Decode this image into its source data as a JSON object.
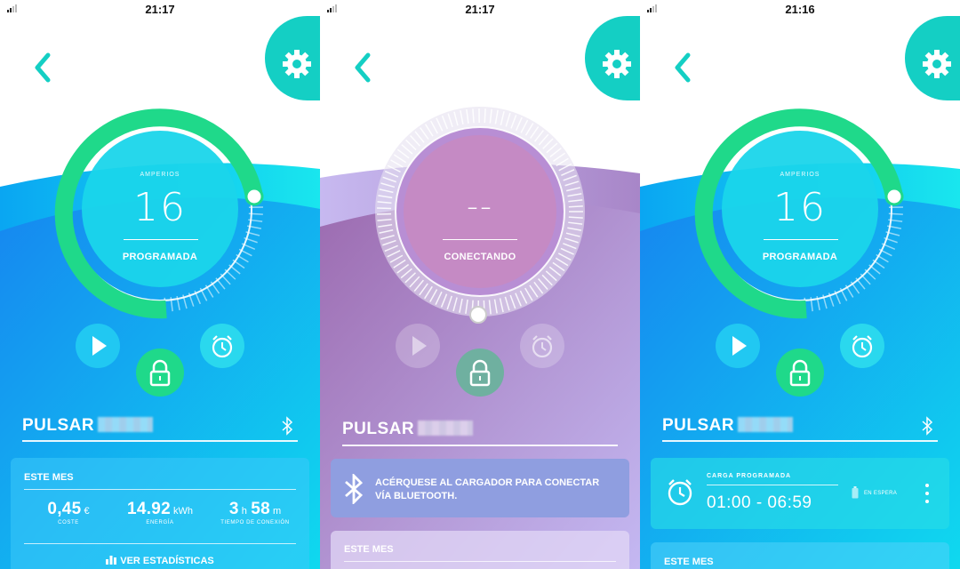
{
  "screens": [
    {
      "time": "21:17",
      "dial": {
        "label": "AMPERIOS",
        "value": "16",
        "state": "PROGRAMADA",
        "level": 0.75
      },
      "device": {
        "name": "PULSAR"
      },
      "stats_card": {
        "title": "ESTE MES",
        "cost": {
          "value": "0,45",
          "unit": "€",
          "label": "COSTE"
        },
        "energy": {
          "value": "14.92",
          "unit": "kWh",
          "label": "ENERGÍA"
        },
        "connection": {
          "h": "3",
          "h_unit": "h",
          "m": "58",
          "m_unit": "m",
          "label": "TIEMPO DE CONEXIÓN"
        },
        "link": "VER ESTADÍSTICAS"
      }
    },
    {
      "time": "21:17",
      "dial": {
        "value": "--",
        "state": "CONECTANDO"
      },
      "device": {
        "name": "PULSAR"
      },
      "notice": {
        "text_line1": "ACÉRQUESE AL CARGADOR PARA CONECTAR",
        "text_line2": "VÍA BLUETOOTH."
      },
      "stats_card": {
        "title": "ESTE MES"
      }
    },
    {
      "time": "21:16",
      "dial": {
        "label": "AMPERIOS",
        "value": "16",
        "state": "PROGRAMADA",
        "level": 0.75
      },
      "device": {
        "name": "PULSAR"
      },
      "schedule_card": {
        "title": "CARGA PROGRAMADA",
        "range": "01:00 - 06:59",
        "status": "EN ESPERA"
      },
      "stats_card": {
        "title": "ESTE MES"
      }
    }
  ],
  "colors": {
    "accent_teal": "#14cfc4",
    "green": "#1fd98a",
    "blue": "#0fb4f0",
    "purple": "#b890d8"
  },
  "icons": [
    "back-chevron-icon",
    "gear-icon",
    "play-icon",
    "lock-icon",
    "alarm-clock-icon",
    "bluetooth-icon",
    "bar-chart-icon",
    "battery-icon",
    "more-vertical-icon"
  ]
}
